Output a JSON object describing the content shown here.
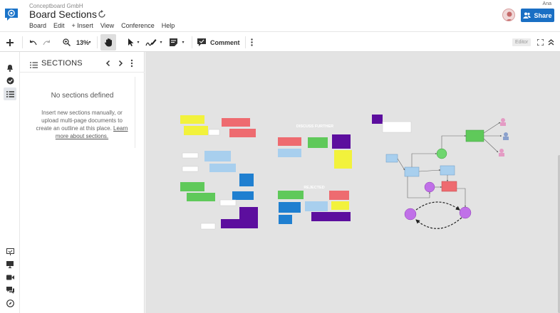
{
  "header": {
    "company": "Conceptboard GmbH",
    "title": "Board Sections",
    "user": "Ana",
    "share_label": "Share",
    "menu": [
      "Board",
      "Edit",
      "+ Insert",
      "View",
      "Conference",
      "Help"
    ]
  },
  "toolbar": {
    "zoom": "13%",
    "comment_label": "Comment",
    "mode_badge": "Editor"
  },
  "sections_panel": {
    "title": "SECTIONS",
    "empty_title": "No sections defined",
    "empty_text": "Insert new sections manually, or upload multi-page documents to create an outline at this place.",
    "empty_link": "Learn more about sections."
  },
  "canvas": {
    "labels": [
      "DISCUSS FURTHER",
      "REJECTED"
    ]
  },
  "colors": {
    "accent": "#1a6fc4",
    "sticky_yellow": "#f2f23c",
    "sticky_red": "#ee6b70",
    "sticky_green": "#5fc95a",
    "sticky_blue": "#a8cfee",
    "card_blue": "#1f7fd0",
    "card_purple": "#5c0e9e",
    "node_green": "#6fd66f",
    "node_purple": "#c070e8"
  }
}
